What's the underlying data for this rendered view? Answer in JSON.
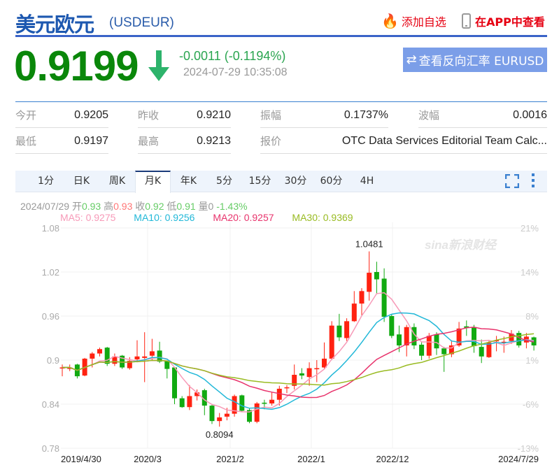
{
  "header": {
    "title": "美元欧元",
    "code": "(USDEUR)",
    "add_watch": "添加自选",
    "view_in_app": "在APP中查看"
  },
  "quote": {
    "price": "0.9199",
    "change": "-0.0011 (-0.1194%)",
    "time": "2024-07-29 10:35:08",
    "reverse_button": "查看反向汇率 EURUSD",
    "up_color": "#e60012",
    "down_color": "#0a870a"
  },
  "stats": [
    {
      "label": "今开",
      "value": "0.9205"
    },
    {
      "label": "昨收",
      "value": "0.9210"
    },
    {
      "label": "振幅",
      "value": "0.1737%"
    },
    {
      "label": "波幅",
      "value": "0.0016"
    },
    {
      "label": "最低",
      "value": "0.9197"
    },
    {
      "label": "最高",
      "value": "0.9213"
    },
    {
      "label": "报价",
      "value": "OTC Data Services Editorial Team Calc..."
    }
  ],
  "tabs": [
    {
      "label": "1分"
    },
    {
      "label": "日K"
    },
    {
      "label": "周K"
    },
    {
      "label": "月K",
      "active": true
    },
    {
      "label": "年K"
    },
    {
      "label": "5分"
    },
    {
      "label": "15分"
    },
    {
      "label": "30分"
    },
    {
      "label": "60分"
    },
    {
      "label": "4H"
    }
  ],
  "info": {
    "date": "2024/07/29",
    "open_label": "开",
    "open": "0.93",
    "high_label": "高",
    "high": "0.93",
    "close_label": "收",
    "close": "0.92",
    "low_label": "低",
    "low": "0.91",
    "vol_label": "量",
    "vol": "0",
    "pct": "-1.43%"
  },
  "ma": {
    "ma5": "MA5: 0.9275",
    "ma10": "MA10: 0.9256",
    "ma20": "MA20: 0.9257",
    "ma30": "MA30: 0.9369"
  },
  "chart_data": {
    "type": "candlestick",
    "title": "USDEUR 月K",
    "ylim": [
      0.78,
      1.08
    ],
    "y_ticks": [
      "1.08",
      "1.02",
      "0.96",
      "0.9",
      "0.84",
      "0.78"
    ],
    "y_right_ticks": [
      "21%",
      "14%",
      "8%",
      "1%",
      "-6%",
      "-13%"
    ],
    "x_ticks": [
      "2019/4/30",
      "2020/3",
      "2021/2",
      "2022/1",
      "2022/12",
      "2024/7/29"
    ],
    "annotations": {
      "max": "1.0481",
      "min": "0.8094"
    },
    "watermark": "sina新浪财经",
    "ma_colors": {
      "ma5": "#f79ab8",
      "ma10": "#22b8d8",
      "ma20": "#e8336c",
      "ma30": "#99bb22"
    },
    "ohlc": [
      [
        0.89,
        0.894,
        0.878,
        0.89
      ],
      [
        0.888,
        0.894,
        0.885,
        0.89
      ],
      [
        0.894,
        0.895,
        0.875,
        0.878
      ],
      [
        0.879,
        0.903,
        0.878,
        0.902
      ],
      [
        0.902,
        0.911,
        0.89,
        0.909
      ],
      [
        0.909,
        0.917,
        0.905,
        0.915
      ],
      [
        0.917,
        0.918,
        0.892,
        0.895
      ],
      [
        0.895,
        0.909,
        0.892,
        0.905
      ],
      [
        0.906,
        0.907,
        0.888,
        0.89
      ],
      [
        0.889,
        0.904,
        0.887,
        0.899
      ],
      [
        0.901,
        0.927,
        0.897,
        0.905
      ],
      [
        0.903,
        0.938,
        0.87,
        0.905
      ],
      [
        0.906,
        0.929,
        0.899,
        0.912
      ],
      [
        0.913,
        0.925,
        0.896,
        0.898
      ],
      [
        0.899,
        0.899,
        0.875,
        0.888
      ],
      [
        0.89,
        0.89,
        0.84,
        0.848
      ],
      [
        0.848,
        0.851,
        0.835,
        0.836
      ],
      [
        0.836,
        0.866,
        0.832,
        0.851
      ],
      [
        0.851,
        0.86,
        0.845,
        0.856
      ],
      [
        0.859,
        0.861,
        0.825,
        0.838
      ],
      [
        0.838,
        0.84,
        0.813,
        0.817
      ],
      [
        0.817,
        0.828,
        0.8094,
        0.822
      ],
      [
        0.823,
        0.835,
        0.818,
        0.827
      ],
      [
        0.827,
        0.853,
        0.823,
        0.851
      ],
      [
        0.852,
        0.853,
        0.829,
        0.831
      ],
      [
        0.832,
        0.835,
        0.814,
        0.816
      ],
      [
        0.816,
        0.843,
        0.814,
        0.841
      ],
      [
        0.842,
        0.846,
        0.833,
        0.841
      ],
      [
        0.841,
        0.856,
        0.838,
        0.846
      ],
      [
        0.846,
        0.865,
        0.838,
        0.861
      ],
      [
        0.862,
        0.866,
        0.855,
        0.863
      ],
      [
        0.865,
        0.894,
        0.86,
        0.88
      ],
      [
        0.882,
        0.889,
        0.874,
        0.879
      ],
      [
        0.877,
        0.897,
        0.865,
        0.889
      ],
      [
        0.888,
        0.9,
        0.87,
        0.889
      ],
      [
        0.89,
        0.924,
        0.888,
        0.902
      ],
      [
        0.902,
        0.953,
        0.9,
        0.947
      ],
      [
        0.947,
        0.963,
        0.926,
        0.931
      ],
      [
        0.93,
        0.957,
        0.926,
        0.953
      ],
      [
        0.953,
        0.994,
        0.952,
        0.977
      ],
      [
        0.977,
        0.998,
        0.96,
        0.994
      ],
      [
        0.993,
        1.0481,
        0.981,
        1.019
      ],
      [
        1.02,
        1.034,
        0.99,
        1.01
      ],
      [
        1.011,
        1.025,
        0.952,
        0.959
      ],
      [
        0.96,
        0.962,
        0.93,
        0.933
      ],
      [
        0.935,
        0.947,
        0.911,
        0.92
      ],
      [
        0.92,
        0.948,
        0.905,
        0.945
      ],
      [
        0.945,
        0.95,
        0.915,
        0.92
      ],
      [
        0.921,
        0.925,
        0.9,
        0.906
      ],
      [
        0.906,
        0.937,
        0.902,
        0.933
      ],
      [
        0.935,
        0.938,
        0.907,
        0.916
      ],
      [
        0.916,
        0.918,
        0.884,
        0.908
      ],
      [
        0.908,
        0.927,
        0.904,
        0.92
      ],
      [
        0.92,
        0.952,
        0.918,
        0.943
      ],
      [
        0.946,
        0.954,
        0.933,
        0.944
      ],
      [
        0.945,
        0.948,
        0.91,
        0.919
      ],
      [
        0.918,
        0.928,
        0.896,
        0.905
      ],
      [
        0.904,
        0.926,
        0.903,
        0.924
      ],
      [
        0.926,
        0.933,
        0.912,
        0.927
      ],
      [
        0.924,
        0.932,
        0.91,
        0.925
      ],
      [
        0.926,
        0.941,
        0.922,
        0.936
      ],
      [
        0.937,
        0.94,
        0.917,
        0.92
      ],
      [
        0.924,
        0.937,
        0.916,
        0.932
      ],
      [
        0.931,
        0.932,
        0.913,
        0.92
      ]
    ]
  }
}
